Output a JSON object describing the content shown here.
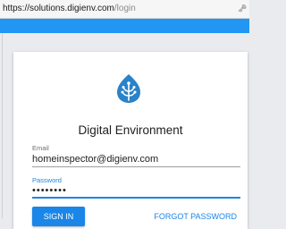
{
  "browser": {
    "url_host": "https://solutions.digienv.com",
    "url_path": "/login",
    "key_icon": "key-icon"
  },
  "colors": {
    "appbar": "#2196f3",
    "primary": "#1a86e8",
    "logo": "#2a82c8"
  },
  "login": {
    "logo_icon": "leaf-logo-icon",
    "brand": "Digital Environment",
    "email_label": "Email",
    "email_value": "homeinspector@digienv.com",
    "password_label": "Password",
    "password_value": "••••••••",
    "signin_label": "SIGN IN",
    "forgot_label": "FORGOT PASSWORD"
  }
}
